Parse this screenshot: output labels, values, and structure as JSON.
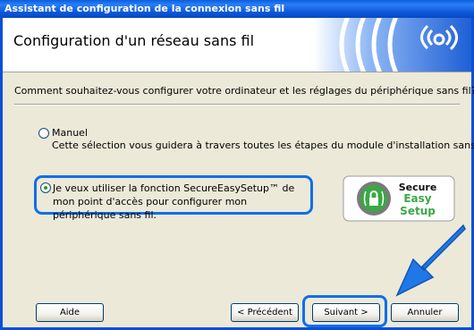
{
  "window": {
    "title": "Assistant de configuration de la connexion sans fil"
  },
  "header": {
    "title": "Configuration d'un réseau sans fil",
    "logo_icon": "wireless-waves-icon"
  },
  "question": "Comment souhaitez-vous configurer votre ordinateur et les réglages du périphérique sans fil?",
  "options": [
    {
      "label": "Manuel",
      "description": "Cette sélection vous guidera à travers toutes les étapes du module d'installation sans fil.",
      "selected": false
    },
    {
      "label": "Je veux utiliser la fonction SecureEasySetup™ de mon point d'accès pour configurer mon périphérique sans fil.",
      "selected": true
    }
  ],
  "badge": {
    "line1": "Secure",
    "line2": "Easy",
    "line3": "Setup",
    "icon": "secure-easy-setup-logo"
  },
  "buttons": {
    "help": "Aide",
    "previous": "< Précédent",
    "next": "Suivant >",
    "cancel": "Annuler"
  },
  "colors": {
    "title_bar": "#0b58d8",
    "highlight": "#0f6fe8",
    "badge_green": "#3aa845",
    "accent_arrow": "#1f78e6"
  }
}
